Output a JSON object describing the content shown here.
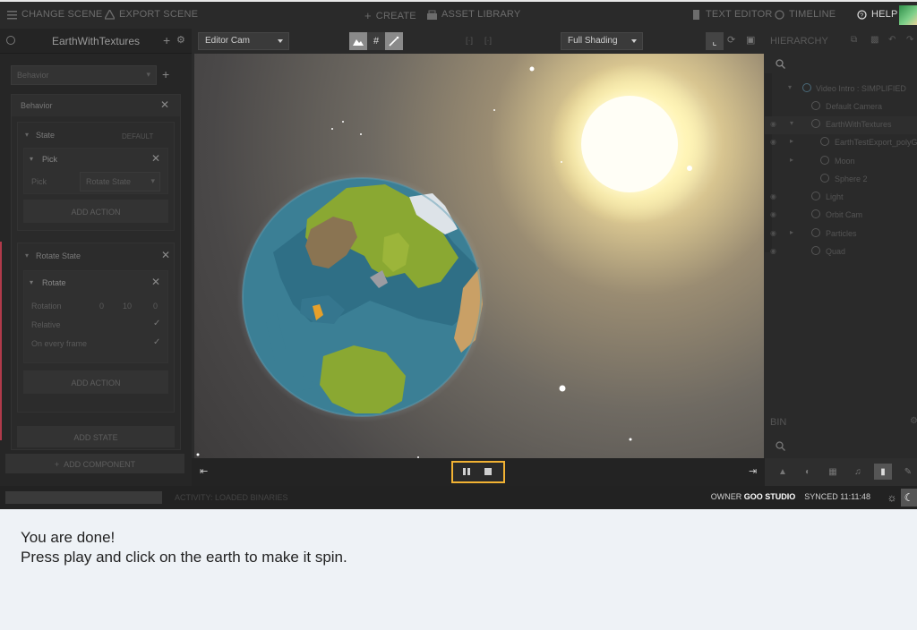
{
  "topbar": {
    "change_scene": "CHANGE SCENE",
    "export_scene": "EXPORT SCENE",
    "create": "CREATE",
    "asset_library": "ASSET LIBRARY",
    "text_editor": "TEXT EDITOR",
    "timeline": "TIMELINE",
    "help": "HELP"
  },
  "left_panel": {
    "entity_name": "EarthWithTextures",
    "component_select": "Behavior",
    "behavior_title": "Behavior",
    "state1": {
      "name": "State",
      "badge": "DEFAULT",
      "action": "Pick",
      "pick_label": "Pick",
      "pick_value": "Rotate State",
      "add_action": "ADD ACTION"
    },
    "state2": {
      "name": "Rotate State",
      "action": "Rotate",
      "rotation_label": "Rotation",
      "rotation": [
        "0",
        "10",
        "0"
      ],
      "relative_label": "Relative",
      "every_frame_label": "On every frame",
      "add_action": "ADD ACTION"
    },
    "add_state": "ADD STATE",
    "add_component": "ADD COMPONENT"
  },
  "viewport": {
    "camera_select": "Editor Cam",
    "shading_select": "Full Shading"
  },
  "hierarchy": {
    "title": "HIERARCHY",
    "items": [
      {
        "label": "Video Intro : SIMPLIFIED"
      },
      {
        "label": "Default Camera"
      },
      {
        "label": "EarthWithTextures"
      },
      {
        "label": "EarthTestExport_polyGlob"
      },
      {
        "label": "Moon"
      },
      {
        "label": "Sphere 2"
      },
      {
        "label": "Light"
      },
      {
        "label": "Orbit Cam"
      },
      {
        "label": "Particles"
      },
      {
        "label": "Quad"
      }
    ]
  },
  "bin": {
    "title": "BIN"
  },
  "status": {
    "activity": "ACTIVITY: LOADED BINARIES",
    "owner_label": "OWNER",
    "owner": "GOO STUDIO",
    "synced": "SYNCED 11:11:48"
  },
  "caption": {
    "line1": "You are done!",
    "line2": "Press play and click on the earth to make it spin."
  },
  "colors": {
    "accent": "#f2b233",
    "panel": "#2b2b2b",
    "caption_bg": "#eef2f6"
  }
}
